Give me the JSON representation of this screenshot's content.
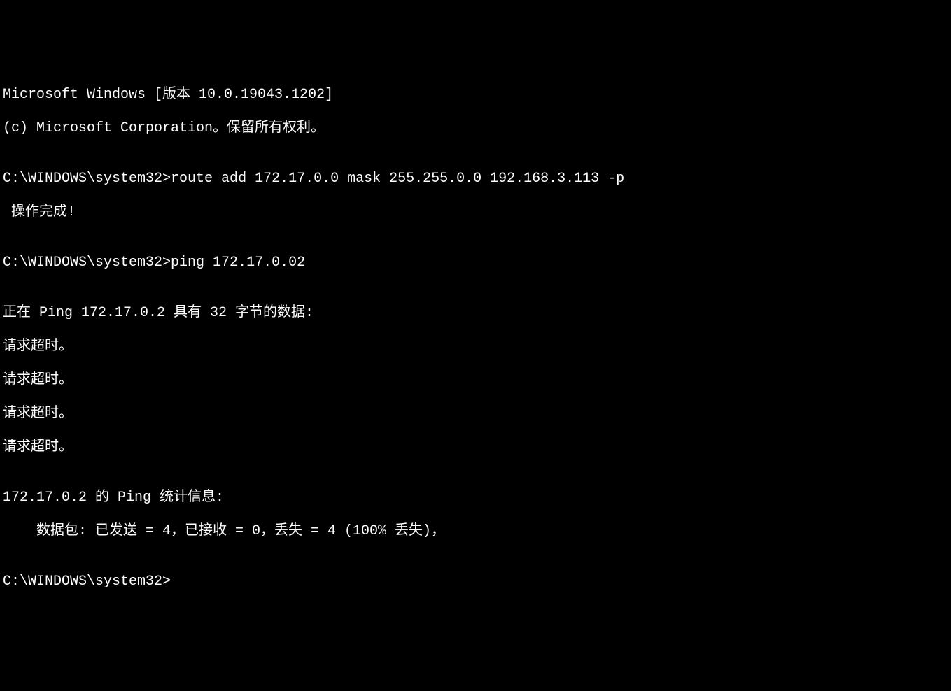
{
  "terminal": {
    "header1": "Microsoft Windows [版本 10.0.19043.1202]",
    "header2": "(c) Microsoft Corporation。保留所有权利。",
    "blank": "",
    "prompt1": "C:\\WINDOWS\\system32>",
    "cmd1": "route add 172.17.0.0 mask 255.255.0.0 192.168.3.113 -p",
    "result1": " 操作完成!",
    "prompt2": "C:\\WINDOWS\\system32>",
    "cmd2": "ping 172.17.0.02",
    "ping_header": "正在 Ping 172.17.0.2 具有 32 字节的数据:",
    "timeout1": "请求超时。",
    "timeout2": "请求超时。",
    "timeout3": "请求超时。",
    "timeout4": "请求超时。",
    "stats_header": "172.17.0.2 的 Ping 统计信息:",
    "stats_detail": "    数据包: 已发送 = 4，已接收 = 0，丢失 = 4 (100% 丢失)，",
    "prompt3": "C:\\WINDOWS\\system32>"
  }
}
